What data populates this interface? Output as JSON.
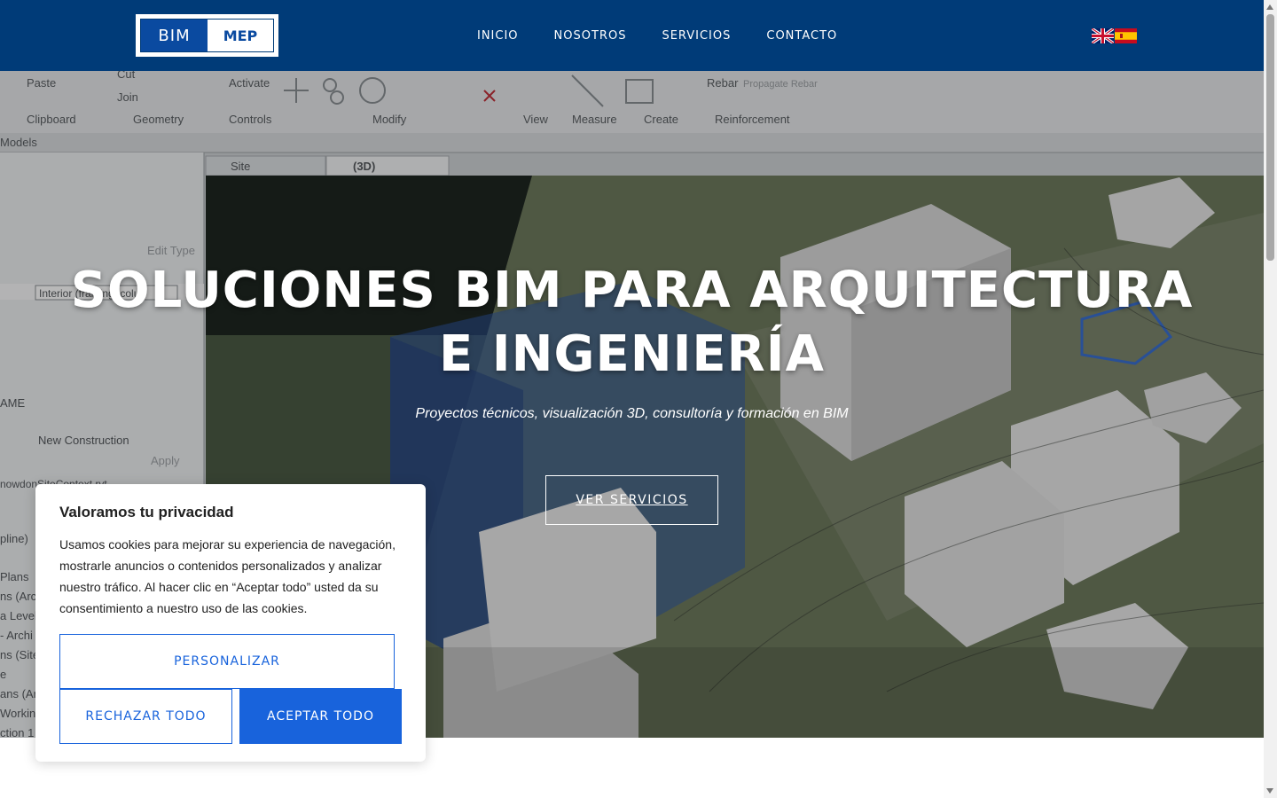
{
  "header": {
    "logo": {
      "left": "BIM",
      "right": "MEP"
    },
    "nav": [
      {
        "label": "INICIO"
      },
      {
        "label": "NOSOTROS"
      },
      {
        "label": "SERVICIOS"
      },
      {
        "label": "CONTACTO"
      }
    ],
    "languages": [
      {
        "name": "uk-flag-icon"
      },
      {
        "name": "spain-flag-icon"
      }
    ],
    "colors": {
      "background": "#003b78",
      "logo_blue": "#0a4aa0"
    }
  },
  "hero": {
    "title_line1": "SOLUCIONES BIM PARA ARQUITECTURA",
    "title_line2": "E INGENIERÍA",
    "subtitle": "Proyectos técnicos, visualización 3D, consultoría y formación en BIM",
    "button": "VER SERVICIOS",
    "background_ui_text": {
      "paste": "Paste",
      "cut": "Cut",
      "join": "Join",
      "activate": "Activate",
      "rebar": "Rebar",
      "propagate_rebar": "Propagate Rebar",
      "ribbon_groups": [
        "Clipboard",
        "Geometry",
        "Controls",
        "Modify",
        "View",
        "Measure",
        "Create",
        "Reinforcement"
      ],
      "models": "Models",
      "tab_site": "Site",
      "tab_3d": "(3D)",
      "edit_type": "Edit Type",
      "interior": "Interior (framing, colu",
      "name_fragment": "AME",
      "new_construction": "New Construction",
      "apply": "Apply",
      "project_file": "nowdonSiteContext.rvt",
      "browser_items": [
        "pline)",
        "Plans",
        "ns (Arch",
        "a Level",
        "- Archi",
        "ns (Site",
        "e",
        "ans (Ar",
        "Workin",
        "ction 1"
      ]
    }
  },
  "cookie_banner": {
    "title": "Valoramos tu privacidad",
    "text": "Usamos cookies para mejorar su experiencia de navegación, mostrarle anuncios o contenidos personalizados y analizar nuestro tráfico. Al hacer clic en “Aceptar todo” usted da su consentimiento a nuestro uso de las cookies.",
    "customize": "PERSONALIZAR",
    "reject": "RECHAZAR TODO",
    "accept": "ACEPTAR TODO",
    "accent": "#1863dc"
  }
}
